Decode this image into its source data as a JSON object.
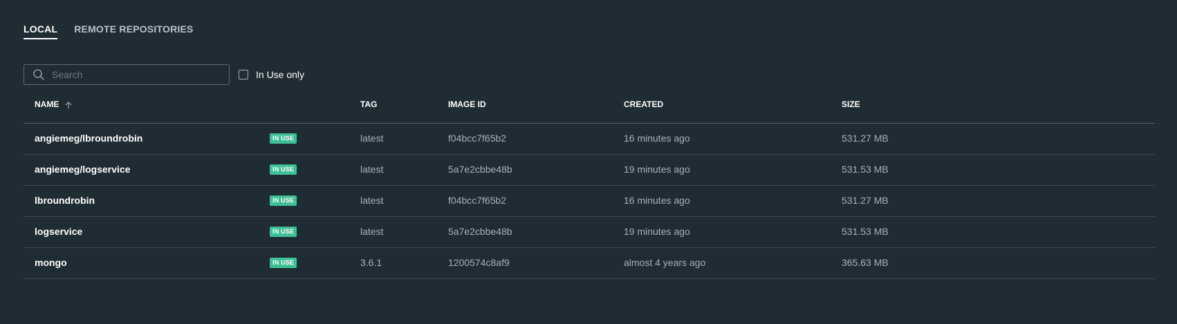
{
  "tabs": [
    {
      "label": "LOCAL",
      "active": true
    },
    {
      "label": "REMOTE REPOSITORIES",
      "active": false
    }
  ],
  "search": {
    "placeholder": "Search",
    "value": ""
  },
  "filter": {
    "label": "In Use only",
    "checked": false
  },
  "table": {
    "columns": {
      "name": "NAME",
      "tag": "TAG",
      "image_id": "IMAGE ID",
      "created": "CREATED",
      "size": "SIZE"
    },
    "sort": {
      "column": "name",
      "direction": "ascending",
      "icon": "arrow-up-icon"
    },
    "rows": [
      {
        "name": "angiemeg/lbroundrobin",
        "badge": "IN USE",
        "tag": "latest",
        "image_id": "f04bcc7f65b2",
        "created": "16 minutes ago",
        "size": "531.27 MB"
      },
      {
        "name": "angiemeg/logservice",
        "badge": "IN USE",
        "tag": "latest",
        "image_id": "5a7e2cbbe48b",
        "created": "19 minutes ago",
        "size": "531.53 MB"
      },
      {
        "name": "lbroundrobin",
        "badge": "IN USE",
        "tag": "latest",
        "image_id": "f04bcc7f65b2",
        "created": "16 minutes ago",
        "size": "531.27 MB"
      },
      {
        "name": "logservice",
        "badge": "IN USE",
        "tag": "latest",
        "image_id": "5a7e2cbbe48b",
        "created": "19 minutes ago",
        "size": "531.53 MB"
      },
      {
        "name": "mongo",
        "badge": "IN USE",
        "tag": "3.6.1",
        "image_id": "1200574c8af9",
        "created": "almost 4 years ago",
        "size": "365.63 MB"
      }
    ]
  },
  "colors": {
    "background": "#202c33",
    "badge": "#3fbf96",
    "divider": "#3d4a51"
  }
}
